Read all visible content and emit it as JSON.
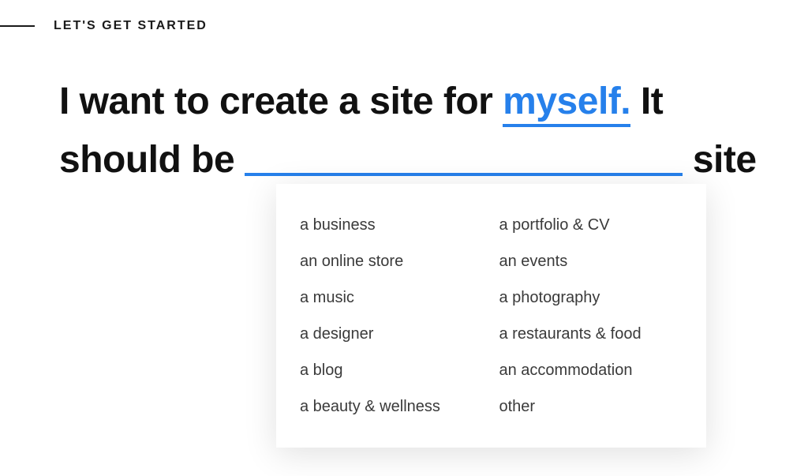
{
  "kicker": "LET'S GET STARTED",
  "sentence": {
    "part1": "I want to create a site for ",
    "slot1_value": "myself.",
    "part2": " It should be ",
    "slot2_value": "",
    "part3": " site"
  },
  "dropdown": {
    "options": [
      "a business",
      "a portfolio & CV",
      "an online store",
      "an events",
      "a music",
      "a photography",
      "a designer",
      "a restaurants & food",
      "a blog",
      "an accommodation",
      "a beauty & wellness",
      "other"
    ]
  },
  "colors": {
    "accent": "#2680eb",
    "text": "#111111",
    "optionText": "#3a3a3a"
  }
}
